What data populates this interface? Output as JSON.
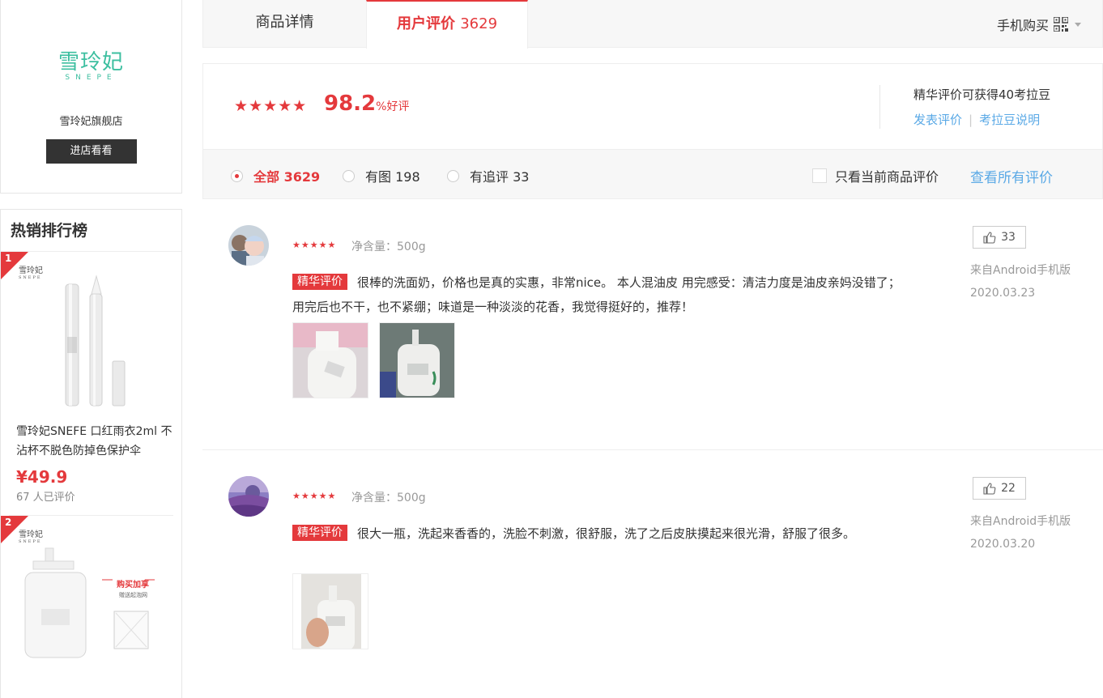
{
  "store": {
    "brand_cn": "雪玲妃",
    "brand_en": "SNEPE",
    "name": "雪玲妃旗舰店",
    "enter_label": "进店看看"
  },
  "hot_list": {
    "title": "热销排行榜",
    "items": [
      {
        "rank": "1",
        "name": "雪玲妃SNEFE 口红雨衣2ml 不沾杯不脱色防掉色保护伞",
        "price": "¥49.9",
        "reviews": "67 人已评价"
      },
      {
        "rank": "2",
        "promo": "购买加享",
        "promo_sub": "赠送起泡网"
      }
    ]
  },
  "tabs": {
    "detail": "商品详情",
    "reviews": "用户评价",
    "reviews_count": "3629",
    "mobile_buy": "手机购买"
  },
  "rating": {
    "good_rate": "98.2",
    "good_rate_suffix": "%好评",
    "essence_note": "精华评价可获得40考拉豆",
    "post_review": "发表评价",
    "pipe": "|",
    "bean_info": "考拉豆说明"
  },
  "filters": {
    "all": "全部 3629",
    "with_pics": "有图 198",
    "followup": "有追评 33",
    "only_current": "只看当前商品评价",
    "view_all": "查看所有评价"
  },
  "reviews": [
    {
      "spec": "净含量：500g",
      "tag": "精华评价",
      "text": "很棒的洗面奶，价格也是真的实惠，非常nice。 本人混油皮 用完感受：清洁力度是油皮亲妈没错了；用完后也不干，也不紧绷；味道是一种淡淡的花香，我觉得挺好的，推荐！",
      "likes": "33",
      "source": "来自Android手机版",
      "date": "2020.03.23"
    },
    {
      "spec": "净含量：500g",
      "tag": "精华评价",
      "text": "很大一瓶，洗起来香香的，洗脸不刺激，很舒服，洗了之后皮肤摸起来很光滑，舒服了很多。",
      "likes": "22",
      "source": "来自Android手机版",
      "date": "2020.03.20"
    }
  ],
  "icons": {
    "qr": "qr-code-icon",
    "like": "thumbs-up-icon",
    "star": "star-icon"
  },
  "colors": {
    "accent": "#e4393c",
    "link": "#5aa9e6",
    "brand": "#3dbfa0"
  }
}
